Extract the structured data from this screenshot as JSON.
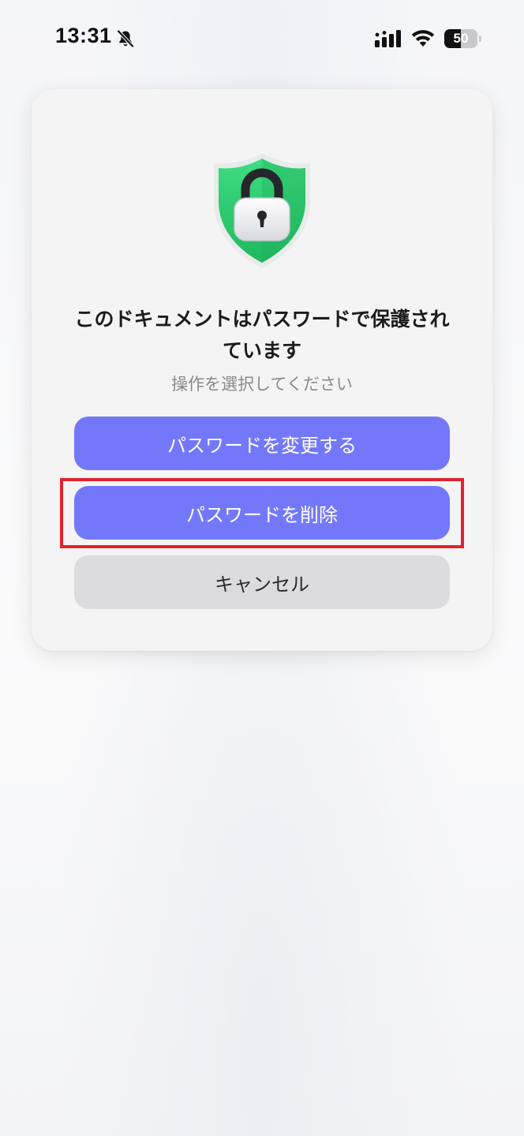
{
  "status_bar": {
    "time": "13:31",
    "silent_icon": "bell-slash-icon",
    "signal_icon": "cellular-signal-icon",
    "wifi_icon": "wifi-icon",
    "battery_level": "50",
    "battery_percent": 50
  },
  "dialog": {
    "icon": "shield-lock-icon",
    "title": "このドキュメントはパスワードで保護されています",
    "subtitle": "操作を選択してください",
    "buttons": {
      "change_password": "パスワードを変更する",
      "remove_password": "パスワードを削除",
      "cancel": "キャンセル"
    }
  },
  "colors": {
    "primary_button": "#7378fb",
    "secondary_button": "#dcdcde",
    "highlight": "#e0232e",
    "shield_green": "#2dcf6f"
  }
}
